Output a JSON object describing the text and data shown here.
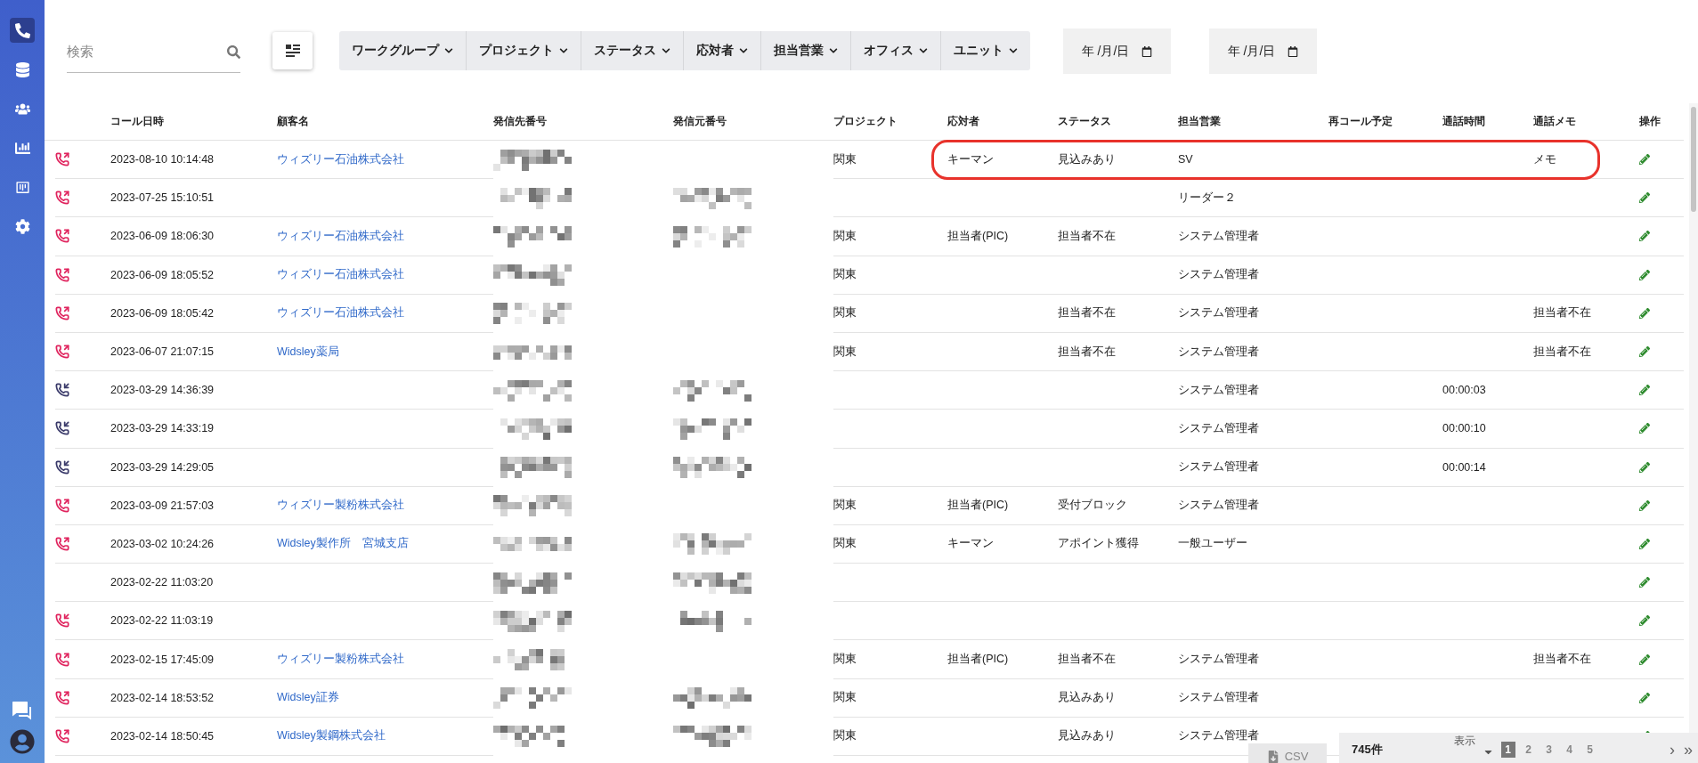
{
  "sidebar": {
    "items": [
      {
        "kind": "phone",
        "selected": true
      },
      {
        "kind": "database",
        "selected": false
      },
      {
        "kind": "users",
        "selected": false
      },
      {
        "kind": "chart",
        "selected": false
      },
      {
        "kind": "board",
        "selected": false
      },
      {
        "kind": "settings",
        "selected": false
      }
    ],
    "bottom": [
      {
        "kind": "help"
      },
      {
        "kind": "account"
      }
    ]
  },
  "toolbar": {
    "search": {
      "placeholder": "検索"
    },
    "filters": [
      "ワークグループ",
      "プロジェクト",
      "ステータス",
      "応対者",
      "担当営業",
      "オフィス",
      "ユニット"
    ],
    "date_fields": [
      {
        "placeholder": "年 /月/日"
      },
      {
        "placeholder": "年 /月/日"
      }
    ]
  },
  "table": {
    "columns": [
      "コール日時",
      "顧客名",
      "発信先番号",
      "発信元番号",
      "プロジェクト",
      "応対者",
      "ステータス",
      "担当営業",
      "再コール予定",
      "通話時間",
      "通話メモ",
      "操作"
    ],
    "rows": [
      {
        "kind": "outgoing",
        "datetime": "2023-08-10 10:14:48",
        "customer": "ウィズリー石油株式会社",
        "source_masked": false,
        "project": "関東",
        "responder": "キーマン",
        "status": "見込みあり",
        "sales": "SV",
        "memo": "メモ",
        "highlighted": true
      },
      {
        "kind": "outgoing",
        "datetime": "2023-07-25 15:10:51",
        "source_masked": true,
        "sales": "リーダー２",
        "highlighted": false
      },
      {
        "kind": "outgoing",
        "datetime": "2023-06-09 18:06:30",
        "customer": "ウィズリー石油株式会社",
        "source_masked": true,
        "project": "関東",
        "responder": "担当者(PIC)",
        "status": "担当者不在",
        "sales": "システム管理者",
        "highlighted": false
      },
      {
        "kind": "outgoing",
        "datetime": "2023-06-09 18:05:52",
        "customer": "ウィズリー石油株式会社",
        "source_masked": false,
        "project": "関東",
        "sales": "システム管理者",
        "highlighted": false
      },
      {
        "kind": "outgoing",
        "datetime": "2023-06-09 18:05:42",
        "customer": "ウィズリー石油株式会社",
        "source_masked": false,
        "project": "関東",
        "status": "担当者不在",
        "sales": "システム管理者",
        "memo": "担当者不在",
        "highlighted": false
      },
      {
        "kind": "outgoing",
        "datetime": "2023-06-07 21:07:15",
        "customer": "Widsley薬局",
        "source_masked": false,
        "project": "関東",
        "status": "担当者不在",
        "sales": "システム管理者",
        "memo": "担当者不在",
        "highlighted": false
      },
      {
        "kind": "incoming",
        "datetime": "2023-03-29 14:36:39",
        "source_masked": true,
        "sales": "システム管理者",
        "duration": "00:00:03",
        "highlighted": false
      },
      {
        "kind": "incoming",
        "datetime": "2023-03-29 14:33:19",
        "source_masked": true,
        "sales": "システム管理者",
        "duration": "00:00:10",
        "highlighted": false
      },
      {
        "kind": "incoming",
        "datetime": "2023-03-29 14:29:05",
        "source_masked": true,
        "sales": "システム管理者",
        "duration": "00:00:14",
        "highlighted": false
      },
      {
        "kind": "outgoing",
        "datetime": "2023-03-09 21:57:03",
        "customer": "ウィズリー製粉株式会社",
        "source_masked": false,
        "project": "関東",
        "responder": "担当者(PIC)",
        "status": "受付ブロック",
        "sales": "システム管理者",
        "highlighted": false
      },
      {
        "kind": "outgoing",
        "datetime": "2023-03-02 10:24:26",
        "customer": "Widsley製作所　宮城支店",
        "source_masked": true,
        "project": "関東",
        "responder": "キーマン",
        "status": "アポイント獲得",
        "sales": "一般ユーザー",
        "highlighted": false
      },
      {
        "kind": "none",
        "datetime": "2023-02-22 11:03:20",
        "source_masked": true,
        "highlighted": false
      },
      {
        "kind": "missed",
        "datetime": "2023-02-22 11:03:19",
        "source_masked": true,
        "highlighted": false
      },
      {
        "kind": "outgoing",
        "datetime": "2023-02-15 17:45:09",
        "customer": "ウィズリー製粉株式会社",
        "source_masked": false,
        "project": "関東",
        "responder": "担当者(PIC)",
        "status": "担当者不在",
        "sales": "システム管理者",
        "memo": "担当者不在",
        "highlighted": false
      },
      {
        "kind": "outgoing",
        "datetime": "2023-02-14 18:53:52",
        "customer": "Widsley証券",
        "source_masked": true,
        "project": "関東",
        "status": "見込みあり",
        "sales": "システム管理者",
        "highlighted": false
      },
      {
        "kind": "outgoing",
        "datetime": "2023-02-14 18:50:45",
        "customer": "Widsley製鋼株式会社",
        "source_masked": true,
        "project": "関東",
        "status": "見込みあり",
        "sales": "システム管理者",
        "highlighted": false
      }
    ]
  },
  "footer": {
    "csv": "CSV",
    "total": "745件",
    "per_page_label": "表示",
    "pages": [
      {
        "label": "1",
        "selected": true
      },
      {
        "label": "2",
        "selected": false
      },
      {
        "label": "3",
        "selected": false
      },
      {
        "label": "4",
        "selected": false
      },
      {
        "label": "5",
        "selected": false
      }
    ],
    "next": "›",
    "last": "»"
  }
}
